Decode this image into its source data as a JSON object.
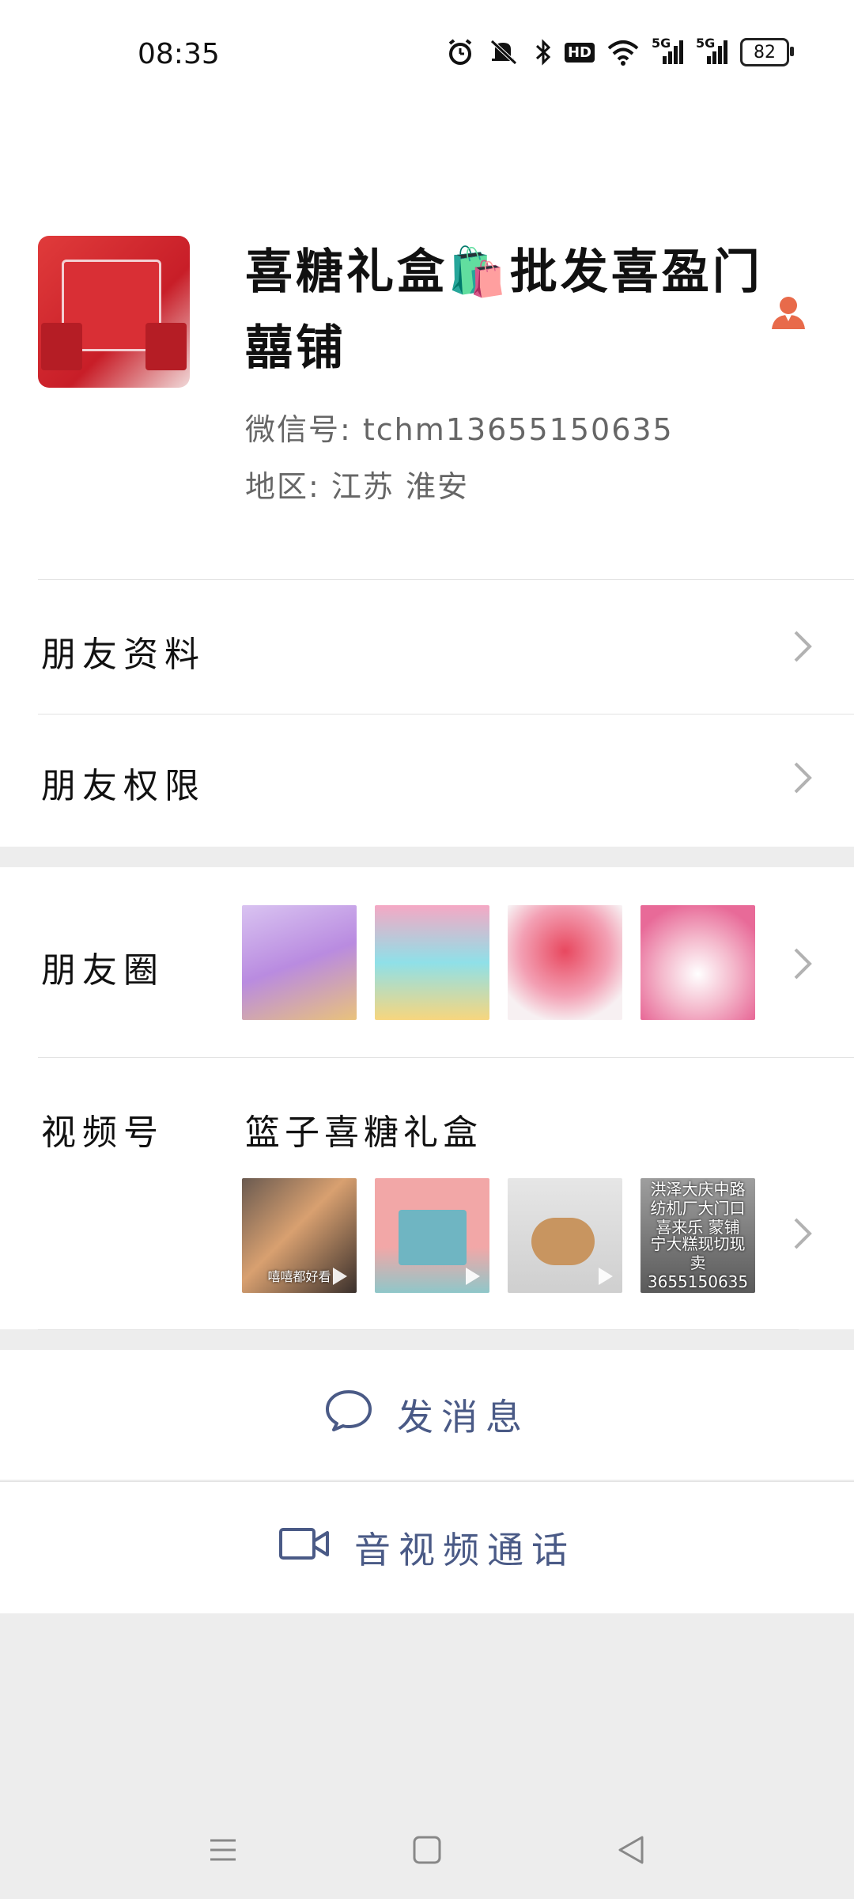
{
  "status_bar": {
    "time": "08:35",
    "hd_label": "HD",
    "network_1": "5G",
    "network_2": "5G",
    "battery": "82"
  },
  "profile": {
    "name": "喜糖礼盒🛍️批发喜盈门囍铺",
    "wechat_id": "微信号: tchm13655150635",
    "region": "地区: 江苏 淮安"
  },
  "rows": {
    "friend_info": "朋友资料",
    "friend_permissions": "朋友权限",
    "moments": "朋友圈",
    "channels": "视频号",
    "channels_title": "篮子喜糖礼盒"
  },
  "moments_thumbs": [
    {
      "color": "#c9a6e4"
    },
    {
      "color": "#f3b3c8"
    },
    {
      "color": "#e85a78"
    },
    {
      "color": "#f09ab6"
    }
  ],
  "channel_thumbs": [
    {
      "caption": "嘻嘻都好看"
    },
    {
      "caption": ""
    },
    {
      "caption": ""
    },
    {
      "caption_top": "洪泽大庆中路 纺机厂大门口 喜来乐 蒙铺",
      "caption_bottom": "宁大糕现切现卖 3655150635"
    }
  ],
  "actions": {
    "send_message": "发消息",
    "av_call": "音视频通话"
  },
  "colors": {
    "accent_blue": "#4a5a86",
    "person_icon": "#e86a4a"
  }
}
